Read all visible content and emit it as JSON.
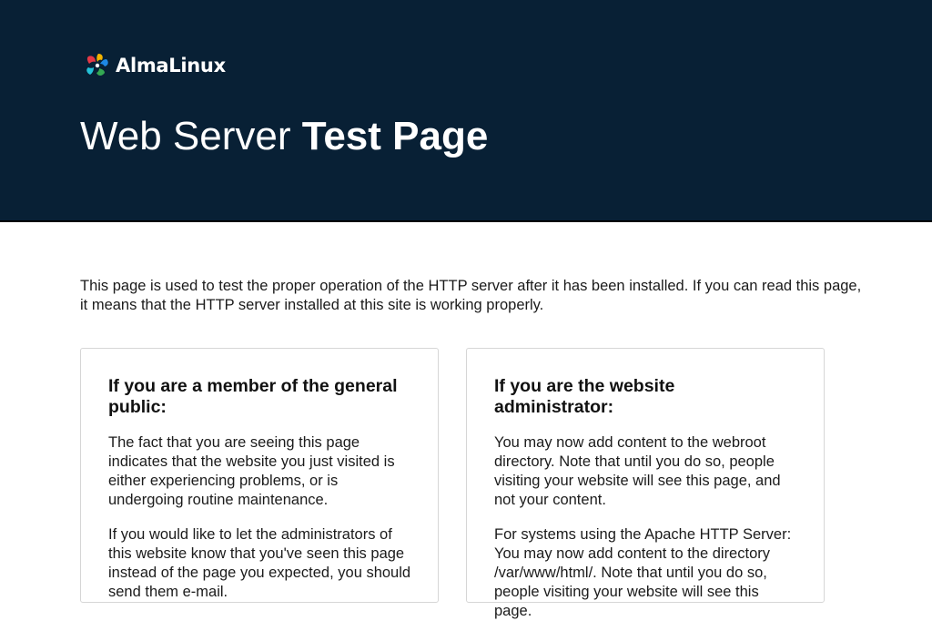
{
  "header": {
    "logo_text": "AlmaLinux",
    "title_light": "Web Server ",
    "title_bold": "Test Page",
    "background": "#082035"
  },
  "intro": "This page is used to test the proper operation of the HTTP server after it has been installed. If you can read this page, it means that the HTTP server installed at this site is working properly.",
  "cards": [
    {
      "heading": "If you are a member of the general public:",
      "paragraphs": [
        "The fact that you are seeing this page indicates that the website you just visited is either experiencing problems, or is undergoing routine maintenance.",
        "If you would like to let the administrators of this website know that you've seen this page instead of the page you expected, you should send them e-mail."
      ]
    },
    {
      "heading": "If you are the website administrator:",
      "paragraphs": [
        "You may now add content to the webroot directory. Note that until you do so, people visiting your website will see this page, and not your content.",
        "For systems using the Apache HTTP Server: You may now add content to the directory /var/www/html/. Note that until you do so, people visiting your website will see this page."
      ]
    }
  ],
  "icons": {
    "logo": "almalinux-logo-icon"
  },
  "colors": {
    "header_bg": "#082035",
    "logo_red": "#e63946",
    "logo_yellow": "#f4b400",
    "logo_blue": "#1e88e5",
    "logo_green": "#34a853",
    "logo_cyan": "#24c2d8"
  }
}
